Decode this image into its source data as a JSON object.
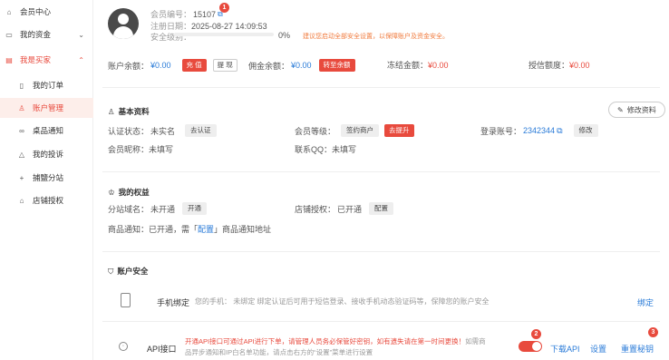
{
  "sidebar": {
    "items": [
      {
        "label": "会员中心",
        "icon": "home-icon"
      },
      {
        "label": "我的资金",
        "icon": "wallet-icon",
        "chevron": "⌄"
      },
      {
        "label": "我是买家",
        "icon": "cart-icon",
        "chevron": "⌃"
      },
      {
        "label": "我的订单",
        "icon": "order-icon"
      },
      {
        "label": "账户管理",
        "icon": "user-icon"
      },
      {
        "label": "桌品通知",
        "icon": "link-icon"
      },
      {
        "label": "我的投诉",
        "icon": "warning-icon"
      },
      {
        "label": "捕鹽分站",
        "icon": "plus-icon"
      },
      {
        "label": "店铺授权",
        "icon": "store-icon"
      }
    ]
  },
  "profile": {
    "member_id_label": "会员编号：",
    "member_id": "15107",
    "badge1": "1",
    "register_label": "注册日期：",
    "register_date": "2025-08-27 14:09:53",
    "security_label": "安全级别：",
    "security_percent": "0%",
    "security_fraction": 0.0,
    "security_tip": "建议您启动全部安全设置，以保障账户及资金安全。"
  },
  "balances": {
    "account_label": "账户余额：",
    "account_value": "¥0.00",
    "recharge_btn": "充 值",
    "withdraw_btn": "提 现",
    "commission_label": "佣金余额：",
    "commission_value": "¥0.00",
    "transfer_btn": "转至余额",
    "frozen_label": "冻结金额：",
    "frozen_value": "¥0.00",
    "credit_label": "授信额度：",
    "credit_value": "¥0.00"
  },
  "basic": {
    "title": "基本资料",
    "edit_btn": "修改资料",
    "auth_label": "认证状态：",
    "auth_value": "未实名",
    "auth_btn": "去认证",
    "level_label": "会员等级：",
    "level_value": "签约商户",
    "upgrade_btn": "去提升",
    "login_label": "登录账号：",
    "login_value": "2342344",
    "modify_btn": "修改",
    "nickname_label": "会员昵称：",
    "nickname_value": "未填写",
    "qq_label": "联系QQ：",
    "qq_value": "未填写"
  },
  "rights": {
    "title": "我的权益",
    "site_label": "分站域名：",
    "site_value": "未开通",
    "site_btn": "开通",
    "store_label": "店铺授权：",
    "store_value": "已开通",
    "store_btn": "配置",
    "notice_prefix": "商品通知：已开通，需「",
    "notice_link": "配置",
    "notice_suffix": "」商品通知地址"
  },
  "security": {
    "title": "账户安全",
    "phone_label": "手机绑定",
    "phone_desc": "您的手机： 未绑定   绑定认证后可用于短信登录、接收手机动态验证码等，保障您的账户安全",
    "phone_action": "绑定",
    "api_label": "API接口",
    "api_warning": "开通API接口可通过API进行下单，请管理人员务必保管好密钥，如有遗失请在第一时间更换！",
    "api_desc_1": "如需商",
    "api_desc_2": "品异步通知和IP白名单功能，请点击右方的“设置”菜单进行设置",
    "badge2": "2",
    "badge3": "3",
    "download_btn": "下载API",
    "settings_btn": "设置",
    "reset_btn": "重置秘钥"
  }
}
